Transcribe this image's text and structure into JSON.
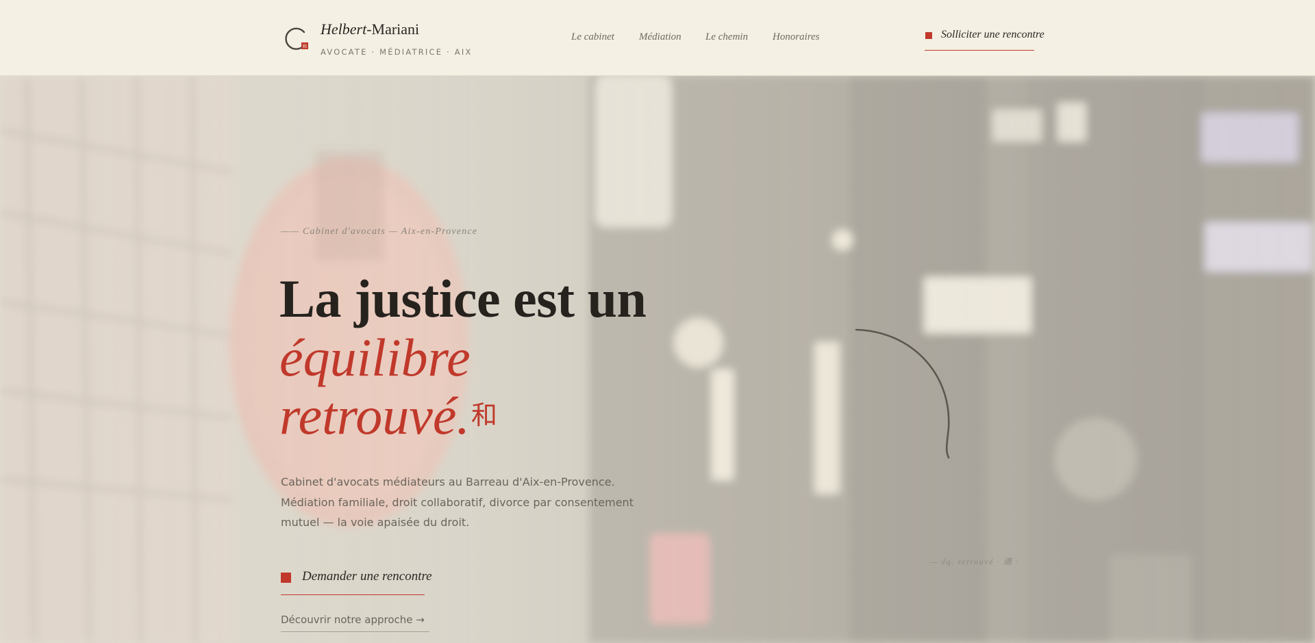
{
  "header": {
    "brand": {
      "name_italic": "Helbert",
      "name_rest": "-Mariani",
      "subtitle": "AVOCATE · MÉDIATRICE · AIX",
      "logo_icon": "enso-circle-icon"
    },
    "nav": [
      {
        "label": "Le cabinet"
      },
      {
        "label": "Médiation"
      },
      {
        "label": "Le chemin"
      },
      {
        "label": "Honoraires"
      }
    ],
    "cta": {
      "label": "Solliciter une rencontre"
    }
  },
  "hero": {
    "eyebrow": "—— Cabinet d'avocats — Aix-en-Provence",
    "title_line1": "La justice est un",
    "title_line2": "équilibre",
    "title_line3": "retrouvé.",
    "kanji": "和",
    "lead": "Cabinet d'avocats médiateurs au Barreau d'Aix-en-Provence. Médiation familiale, droit collaboratif, divorce par consentement mutuel — la voie apaisée du droit.",
    "cta_primary": "Demander une rencontre",
    "cta_secondary": "Découvrir notre approche →",
    "caption": "— éq. retrouvé · 適 ·"
  },
  "colors": {
    "accent": "#c0392b",
    "paper": "#f3efe2",
    "ink": "#26221e"
  }
}
